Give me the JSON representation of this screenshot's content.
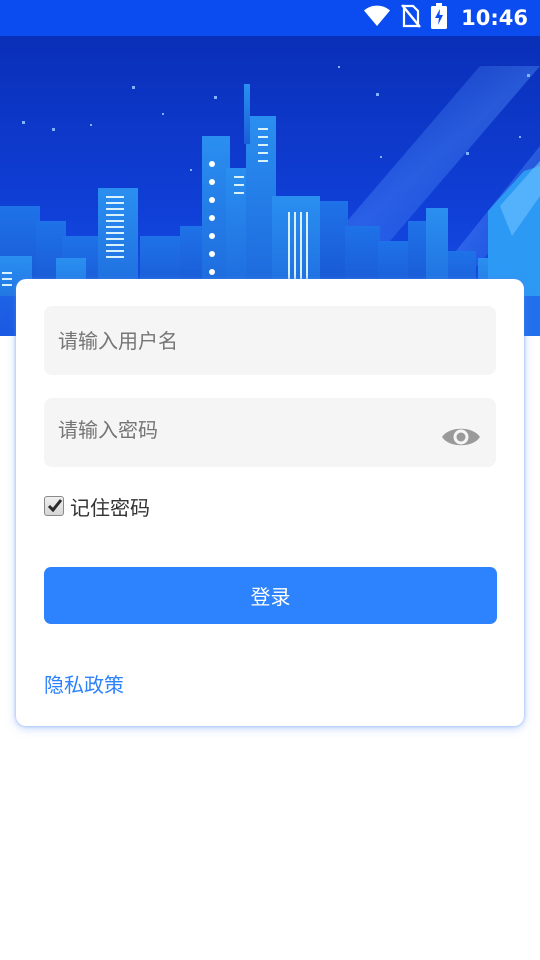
{
  "status_bar": {
    "time": "10:46",
    "icons": [
      "wifi-icon",
      "no-sim-icon",
      "battery-charging-icon"
    ],
    "background": "#0a4cf0"
  },
  "login": {
    "username_placeholder": "请输入用户名",
    "password_placeholder": "请输入密码",
    "remember_label": "记住密码",
    "remember_checked": true,
    "login_button": "登录",
    "privacy_link": "隐私政策",
    "password_toggle_icon": "eye-icon"
  },
  "colors": {
    "accent": "#2d82fd",
    "field_background": "#f5f5f5",
    "hero_background": "#0b33c9"
  }
}
